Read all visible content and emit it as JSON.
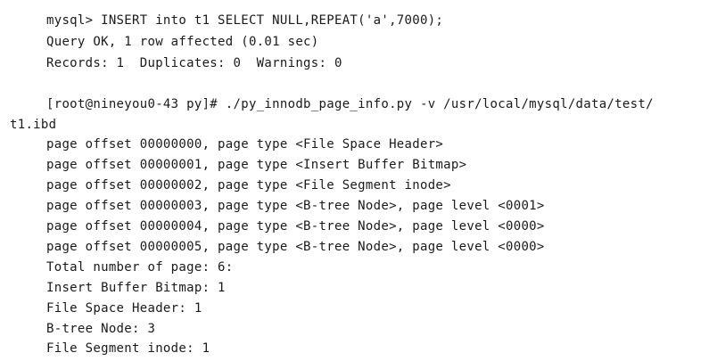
{
  "mysql_block": {
    "command": "mysql> INSERT into t1 SELECT NULL,REPEAT('a',7000);",
    "result": "Query OK, 1 row affected (0.01 sec)",
    "records": "Records: 1  Duplicates: 0  Warnings: 0"
  },
  "shell_block": {
    "prompt_command": "[root@nineyou0-43 py]# ./py_innodb_page_info.py -v /usr/local/mysql/data/test/",
    "wrapped_path": "t1.ibd"
  },
  "pages": [
    "page offset 00000000, page type <File Space Header>",
    "page offset 00000001, page type <Insert Buffer Bitmap>",
    "page offset 00000002, page type <File Segment inode>",
    "page offset 00000003, page type <B-tree Node>, page level <0001>",
    "page offset 00000004, page type <B-tree Node>, page level <0000>",
    "page offset 00000005, page type <B-tree Node>, page level <0000>"
  ],
  "summary": [
    "Total number of page: 6:",
    "Insert Buffer Bitmap: 1",
    "File Space Header: 1",
    "B-tree Node: 3",
    "File Segment inode: 1"
  ]
}
